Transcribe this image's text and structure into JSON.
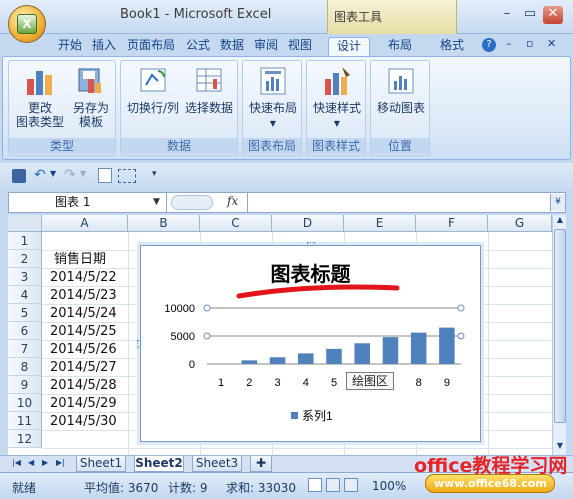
{
  "window": {
    "title": "Book1 - Microsoft Excel",
    "context_tab_group": "图表工具"
  },
  "tabs": [
    {
      "label": "开始"
    },
    {
      "label": "插入"
    },
    {
      "label": "页面布局"
    },
    {
      "label": "公式"
    },
    {
      "label": "数据"
    },
    {
      "label": "审阅"
    },
    {
      "label": "视图"
    },
    {
      "label": "设计",
      "active": true
    },
    {
      "label": "布局"
    },
    {
      "label": "格式"
    }
  ],
  "ribbon": {
    "groups": [
      {
        "label": "类型",
        "buttons": [
          {
            "label": "更改\n图表类型"
          },
          {
            "label": "另存为\n模板"
          }
        ]
      },
      {
        "label": "数据",
        "buttons": [
          {
            "label": "切换行/列"
          },
          {
            "label": "选择数据"
          }
        ]
      },
      {
        "label": "图表布局",
        "buttons": [
          {
            "label": "快速布局"
          }
        ]
      },
      {
        "label": "图表样式",
        "buttons": [
          {
            "label": "快速样式"
          }
        ]
      },
      {
        "label": "位置",
        "buttons": [
          {
            "label": "移动图表"
          }
        ]
      }
    ]
  },
  "formula_bar": {
    "name_box": "图表 1",
    "fx": "fx",
    "formula": ""
  },
  "grid": {
    "columns": [
      "A",
      "B",
      "C",
      "D",
      "E",
      "F",
      "G"
    ],
    "rows": [
      "1",
      "2",
      "3",
      "4",
      "5",
      "6",
      "7",
      "8",
      "9",
      "10",
      "11",
      "12"
    ],
    "cells": {
      "A2": "销售日期",
      "A3": "2014/5/22",
      "A4": "2014/5/23",
      "A5": "2014/5/24",
      "A6": "2014/5/25",
      "A7": "2014/5/26",
      "A8": "2014/5/27",
      "A9": "2014/5/28",
      "A10": "2014/5/29",
      "A11": "2014/5/30"
    }
  },
  "chart": {
    "title": "图表标题",
    "tooltip": "绘图区",
    "title_underline_color": "#e3151b",
    "bar_color": "#4f81bd"
  },
  "chart_data": {
    "type": "bar",
    "title": "图表标题",
    "categories": [
      "1",
      "2",
      "3",
      "4",
      "5",
      "6",
      "7",
      "8",
      "9"
    ],
    "series": [
      {
        "name": "系列1",
        "values": [
          0,
          650,
          1200,
          1900,
          2700,
          3700,
          4800,
          5600,
          6500
        ]
      }
    ],
    "ylim": [
      0,
      10000
    ],
    "yticks": [
      "0",
      "5000",
      "10000"
    ],
    "legend": "bottom",
    "grid": true
  },
  "sheets": [
    {
      "label": "Sheet1"
    },
    {
      "label": "Sheet2",
      "active": true
    },
    {
      "label": "Sheet3"
    }
  ],
  "status": {
    "ready": "就绪",
    "average": "平均值: 3670",
    "count": "计数: 9",
    "sum": "求和: 33030",
    "zoom": "100%"
  },
  "watermark": {
    "text": "office教程学习网",
    "logo_text": "www.office68.com"
  }
}
